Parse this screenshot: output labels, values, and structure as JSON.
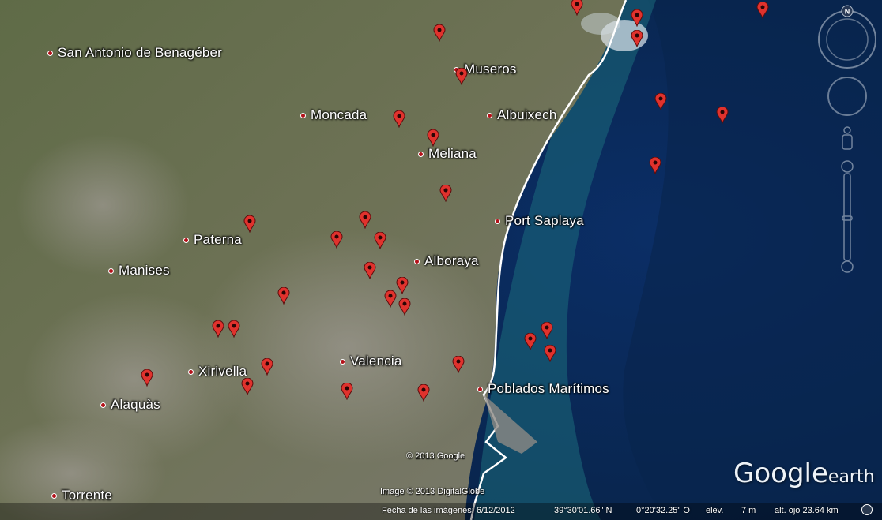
{
  "places": [
    {
      "name": "San Antonio de Benagéber"
    },
    {
      "name": "Museros"
    },
    {
      "name": "Moncada"
    },
    {
      "name": "Albuixech"
    },
    {
      "name": "Meliana"
    },
    {
      "name": "Port Saplaya"
    },
    {
      "name": "Paterna"
    },
    {
      "name": "Manises"
    },
    {
      "name": "Alboraya"
    },
    {
      "name": "Xirivella"
    },
    {
      "name": "Valencia"
    },
    {
      "name": "Poblados Marítimos"
    },
    {
      "name": "Alaquàs"
    },
    {
      "name": "Torrente"
    }
  ],
  "credits": {
    "google": "© 2013 Google",
    "imagery": "Image © 2013 DigitalGlobe"
  },
  "status": {
    "date": "Fecha de las imágenes: 6/12/2012",
    "lat": "39°30'01.66\" N",
    "lon": "0°20'32.25\" O",
    "elev_label": "elev.",
    "elev_value": "7 m",
    "eye_alt": "alt. ojo  23.64 km"
  },
  "logo": {
    "google": "Google",
    "earth": "earth"
  },
  "nav": {
    "north": "N"
  },
  "colors": {
    "pin": "#e0322d",
    "coast": "#ffffff",
    "sea": "#0b2a54",
    "land": "#5e6b4a"
  }
}
